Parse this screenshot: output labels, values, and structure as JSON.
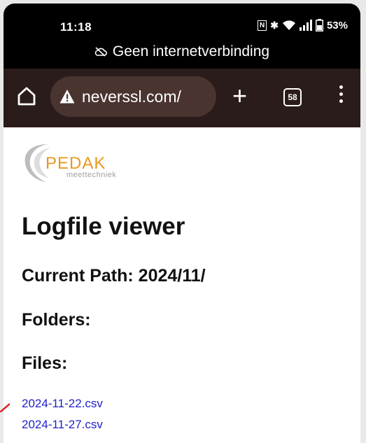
{
  "status_bar": {
    "time": "11:18",
    "nfc_label": "N",
    "battery_percent": "53%",
    "offline_notice": "Geen internetverbinding"
  },
  "toolbar": {
    "url": "neverssl.com/",
    "tab_count": "58",
    "icons": [
      "home-icon",
      "warning-icon",
      "plus-icon",
      "tabs-icon",
      "menu-icon"
    ]
  },
  "page": {
    "logo": {
      "brand": "PEDAK",
      "tagline": "meettechniek"
    },
    "title": "Logfile viewer",
    "current_path": "Current Path: 2024/11/",
    "folders_heading": "Folders:",
    "files_heading": "Files:",
    "files": [
      "2024-11-22.csv",
      "2024-11-27.csv"
    ]
  },
  "colors": {
    "toolbar_bg": "#2a1c1a",
    "omnibox_bg": "#4a3430",
    "link": "#2121cc",
    "logo_orange": "#e69a1e"
  }
}
